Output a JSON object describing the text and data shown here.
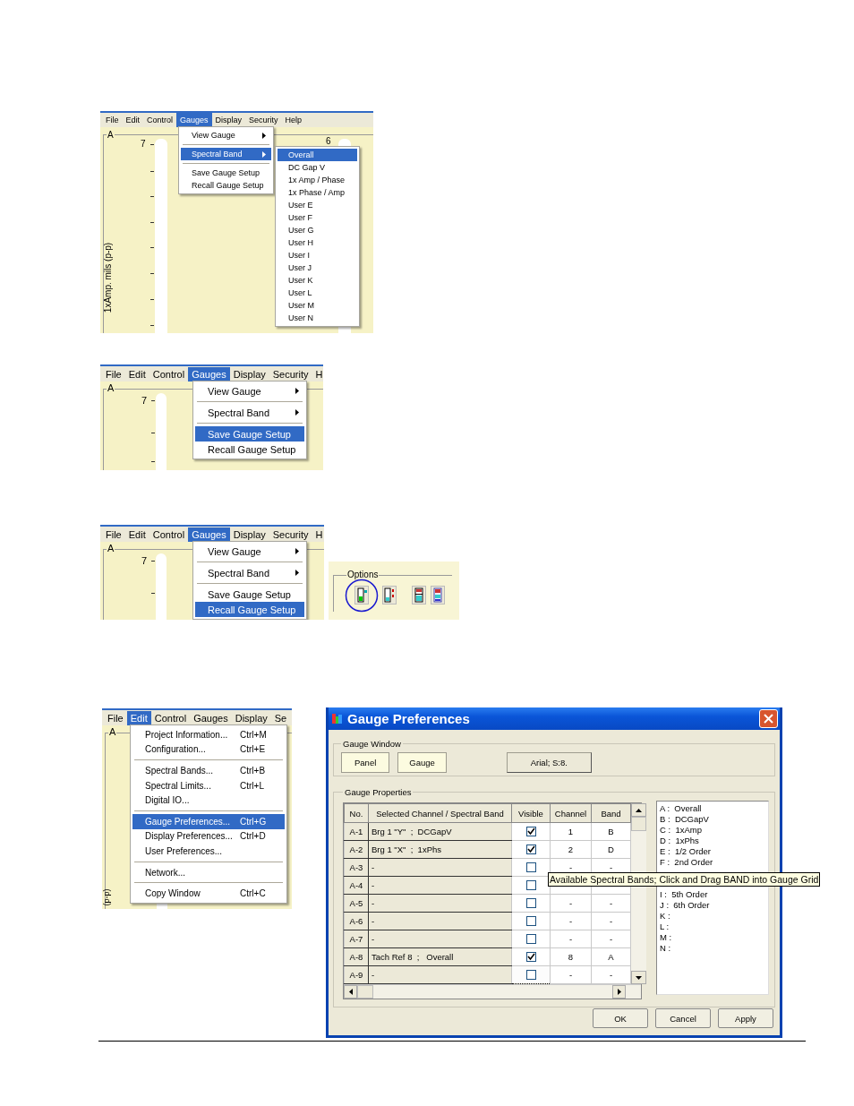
{
  "shots": [
    {
      "menu_bar": [
        {
          "label": "File",
          "selected": false
        },
        {
          "label": "Edit",
          "selected": false
        },
        {
          "label": "Control",
          "selected": false
        },
        {
          "label": "Gauges",
          "selected": true
        },
        {
          "label": "Display",
          "selected": false
        },
        {
          "label": "Security",
          "selected": false
        },
        {
          "label": "Help",
          "selected": false
        }
      ],
      "panel_label": "A",
      "scale_label": "7",
      "second_scale_label": "6",
      "axis_label": "1xAmp. mils (p-p)",
      "menu": [
        {
          "kind": "item",
          "label": "View Gauge",
          "has_submenu": true,
          "selected": false
        },
        {
          "kind": "separator"
        },
        {
          "kind": "item",
          "label": "Spectral Band",
          "has_submenu": true,
          "selected": true
        },
        {
          "kind": "separator"
        },
        {
          "kind": "item",
          "label": "Save Gauge Setup",
          "has_submenu": false,
          "selected": false
        },
        {
          "kind": "item",
          "label": "Recall Gauge Setup",
          "has_submenu": false,
          "selected": false
        }
      ],
      "submenu": [
        {
          "kind": "item",
          "label": "Overall",
          "selected": true
        },
        {
          "kind": "item",
          "label": "DC Gap V",
          "selected": false
        },
        {
          "kind": "item",
          "label": "1x Amp / Phase",
          "selected": false
        },
        {
          "kind": "item",
          "label": "1x Phase / Amp",
          "selected": false
        },
        {
          "kind": "item",
          "label": "User E",
          "selected": false
        },
        {
          "kind": "item",
          "label": "User F",
          "selected": false
        },
        {
          "kind": "item",
          "label": "User G",
          "selected": false
        },
        {
          "kind": "item",
          "label": "User H",
          "selected": false
        },
        {
          "kind": "item",
          "label": "User I",
          "selected": false
        },
        {
          "kind": "item",
          "label": "User J",
          "selected": false
        },
        {
          "kind": "item",
          "label": "User K",
          "selected": false
        },
        {
          "kind": "item",
          "label": "User L",
          "selected": false
        },
        {
          "kind": "item",
          "label": "User M",
          "selected": false
        },
        {
          "kind": "item",
          "label": "User N",
          "selected": false
        }
      ]
    },
    {
      "menu_bar": [
        {
          "label": "File",
          "selected": false
        },
        {
          "label": "Edit",
          "selected": false
        },
        {
          "label": "Control",
          "selected": false
        },
        {
          "label": "Gauges",
          "selected": true
        },
        {
          "label": "Display",
          "selected": false
        },
        {
          "label": "Security",
          "selected": false
        },
        {
          "label": "H",
          "selected": false
        }
      ],
      "panel_label": "A",
      "scale_label": "7",
      "menu": [
        {
          "kind": "item",
          "label": "View Gauge",
          "has_submenu": true,
          "selected": false
        },
        {
          "kind": "separator"
        },
        {
          "kind": "item",
          "label": "Spectral Band",
          "has_submenu": true,
          "selected": false
        },
        {
          "kind": "separator"
        },
        {
          "kind": "item",
          "label": "Save Gauge Setup",
          "has_submenu": false,
          "selected": true
        },
        {
          "kind": "item",
          "label": "Recall Gauge Setup",
          "has_submenu": false,
          "selected": false
        }
      ]
    },
    {
      "menu_bar": [
        {
          "label": "File",
          "selected": false
        },
        {
          "label": "Edit",
          "selected": false
        },
        {
          "label": "Control",
          "selected": false
        },
        {
          "label": "Gauges",
          "selected": true
        },
        {
          "label": "Display",
          "selected": false
        },
        {
          "label": "Security",
          "selected": false
        },
        {
          "label": "H",
          "selected": false
        }
      ],
      "panel_label": "A",
      "scale_label": "7",
      "menu": [
        {
          "kind": "item",
          "label": "View Gauge",
          "has_submenu": true,
          "selected": false
        },
        {
          "kind": "separator"
        },
        {
          "kind": "item",
          "label": "Spectral Band",
          "has_submenu": true,
          "selected": false
        },
        {
          "kind": "separator"
        },
        {
          "kind": "item",
          "label": "Save Gauge Setup",
          "has_submenu": false,
          "selected": false
        },
        {
          "kind": "item",
          "label": "Recall Gauge Setup",
          "has_submenu": false,
          "selected": true
        }
      ],
      "options": {
        "title": "Options",
        "buttons": [
          {
            "kind": "bar",
            "highlighted": true
          },
          {
            "kind": "digits",
            "highlighted": false
          },
          {
            "kind": "split",
            "highlighted": false
          },
          {
            "kind": "stack",
            "highlighted": false
          }
        ]
      }
    },
    {
      "menu_bar": [
        {
          "label": "File",
          "selected": false
        },
        {
          "label": "Edit",
          "selected": true
        },
        {
          "label": "Control",
          "selected": false
        },
        {
          "label": "Gauges",
          "selected": false
        },
        {
          "label": "Display",
          "selected": false
        },
        {
          "label": "Se",
          "selected": false
        }
      ],
      "panel_label": "A",
      "axis_label": "(p-p)",
      "menu": [
        {
          "kind": "item",
          "label": "Project Information...",
          "shortcut": "Ctrl+M",
          "selected": false
        },
        {
          "kind": "item",
          "label": "Configuration...",
          "shortcut": "Ctrl+E",
          "selected": false
        },
        {
          "kind": "separator"
        },
        {
          "kind": "item",
          "label": "Spectral Bands...",
          "shortcut": "Ctrl+B",
          "selected": false
        },
        {
          "kind": "item",
          "label": "Spectral Limits...",
          "shortcut": "Ctrl+L",
          "selected": false
        },
        {
          "kind": "item",
          "label": "Digital IO...",
          "selected": false
        },
        {
          "kind": "separator"
        },
        {
          "kind": "item",
          "label": "Gauge Preferences...",
          "shortcut": "Ctrl+G",
          "selected": true
        },
        {
          "kind": "item",
          "label": "Display Preferences...",
          "shortcut": "Ctrl+D",
          "selected": false
        },
        {
          "kind": "item",
          "label": "User Preferences...",
          "selected": false
        },
        {
          "kind": "separator"
        },
        {
          "kind": "item",
          "label": "Network...",
          "selected": false
        },
        {
          "kind": "separator"
        },
        {
          "kind": "item",
          "label": "Copy Window",
          "shortcut": "Ctrl+C",
          "selected": false
        }
      ]
    }
  ],
  "dialog": {
    "title": "Gauge Preferences",
    "gauge_window": {
      "title": "Gauge Window",
      "buttons": [
        "Panel",
        "Gauge"
      ],
      "font_button": "Arial; S:8."
    },
    "gauge_properties": {
      "title": "Gauge Properties",
      "columns": [
        "No.",
        "Selected Channel / Spectral Band",
        "Visible",
        "Channel",
        "Band"
      ],
      "rows": [
        {
          "no": "A-1",
          "band_text": "Brg 1 \"Y\"  ;  DCGapV",
          "visible": true,
          "focused": false,
          "channel": "1",
          "band": "B"
        },
        {
          "no": "A-2",
          "band_text": "Brg 1 \"X\"  ;  1xPhs",
          "visible": true,
          "focused": false,
          "channel": "2",
          "band": "D"
        },
        {
          "no": "A-3",
          "band_text": "-",
          "visible": false,
          "focused": false,
          "channel": "-",
          "band": "-"
        },
        {
          "no": "A-4",
          "band_text": "-",
          "visible": false,
          "focused": false
        },
        {
          "no": "A-5",
          "band_text": "-",
          "visible": false,
          "focused": false,
          "channel": "-",
          "band": "-"
        },
        {
          "no": "A-6",
          "band_text": "-",
          "visible": false,
          "focused": false,
          "channel": "-",
          "band": "-"
        },
        {
          "no": "A-7",
          "band_text": "-",
          "visible": false,
          "focused": false,
          "channel": "-",
          "band": "-"
        },
        {
          "no": "A-8",
          "band_text": "Tach Ref 8  ;   Overall",
          "visible": true,
          "focused": false,
          "channel": "8",
          "band": "A"
        },
        {
          "no": "A-9",
          "band_text": "-",
          "visible": false,
          "focused": true,
          "channel": "-",
          "band": "-"
        }
      ],
      "band_list": [
        "A :  Overall",
        "B :  DCGapV",
        "C :  1xAmp",
        "D :  1xPhs",
        "E :  1/2 Order",
        "F :  2nd Order"
      ],
      "band_list_lower": [
        "I :  5th Order",
        "J :  6th Order",
        "K :",
        "L :",
        "M :",
        "N :"
      ]
    },
    "tooltip": "Available Spectral Bands; Click and Drag BAND into Gauge Grid",
    "buttons": [
      "OK",
      "Cancel",
      "Apply"
    ]
  }
}
